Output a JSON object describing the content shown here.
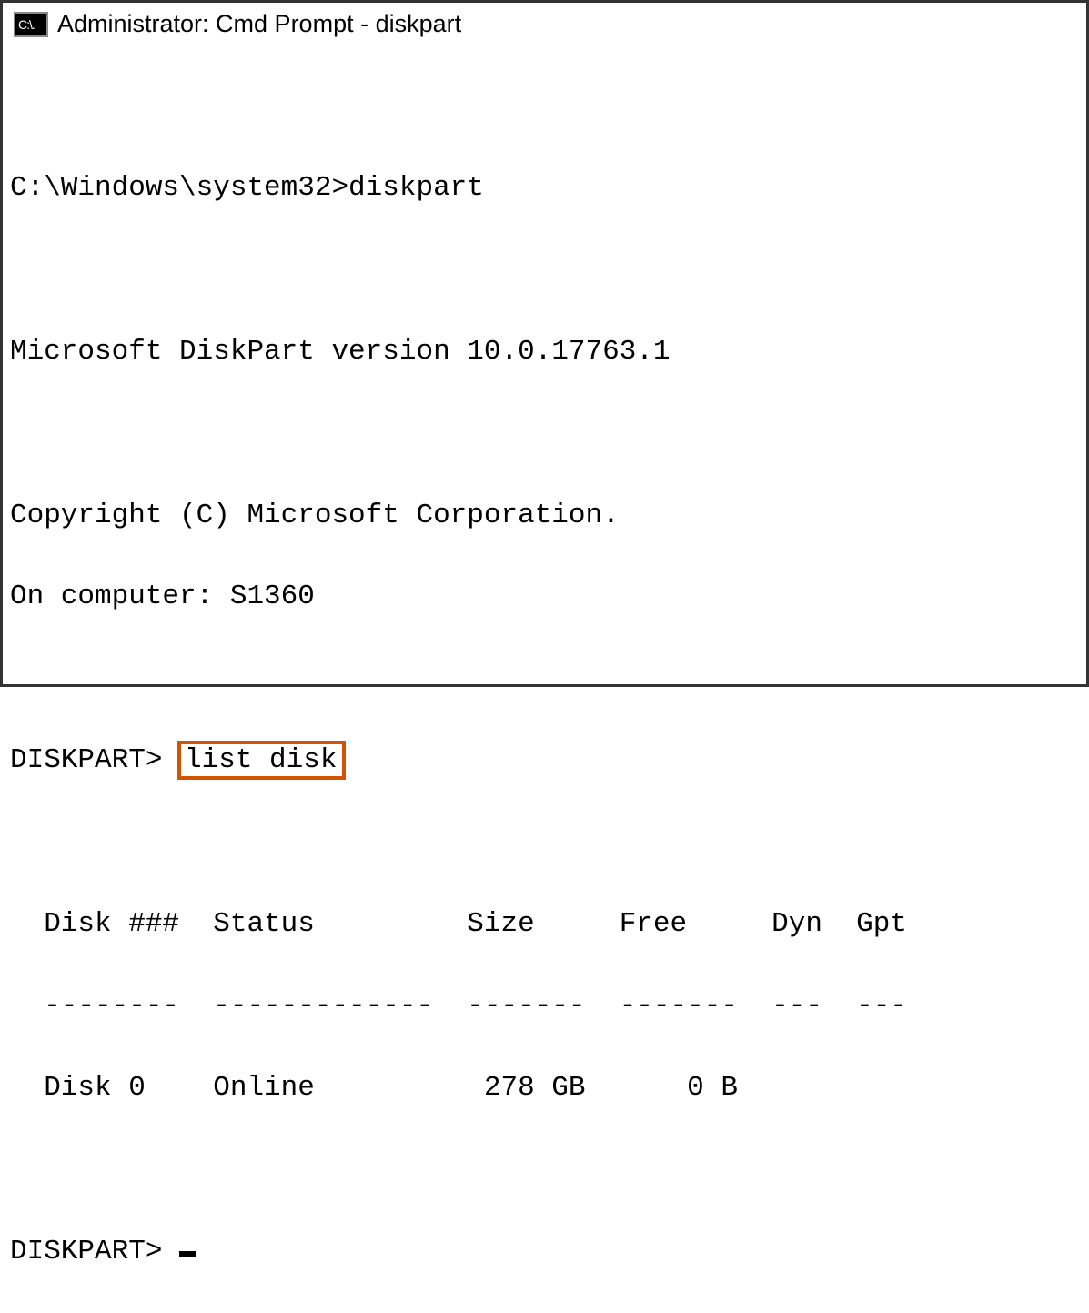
{
  "titlebar": {
    "icon_label": "C:\\.",
    "title": "Administrator: Cmd Prompt - diskpart"
  },
  "terminal": {
    "prompt_line": "C:\\Windows\\system32>diskpart",
    "version_line": "Microsoft DiskPart version 10.0.17763.1",
    "copyright_line": "Copyright (C) Microsoft Corporation.",
    "computer_line": "On computer: S1360",
    "diskpart_prompt": "DISKPART> ",
    "highlighted_command": "list disk",
    "table": {
      "header": "  Disk ###  Status         Size     Free     Dyn  Gpt",
      "divider": "  --------  -------------  -------  -------  ---  ---",
      "row": "  Disk 0    Online          278 GB      0 B"
    },
    "final_prompt": "DISKPART> "
  }
}
